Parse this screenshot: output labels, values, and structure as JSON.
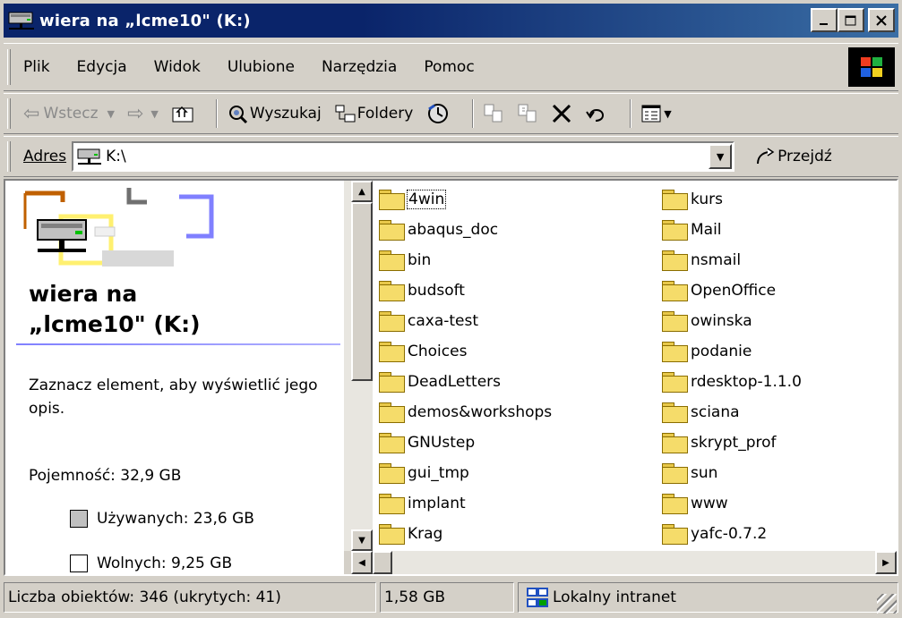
{
  "window": {
    "title": "wiera na „lcme10\" (K:)",
    "icon": "network-drive-icon"
  },
  "menu": {
    "items": [
      "Plik",
      "Edycja",
      "Widok",
      "Ulubione",
      "Narzędzia",
      "Pomoc"
    ]
  },
  "toolbar": {
    "back_label": "Wstecz",
    "search_label": "Wyszukaj",
    "folders_label": "Foldery"
  },
  "address": {
    "label": "Adres",
    "value": "K:\\",
    "go_label": "Przejdź"
  },
  "info_pane": {
    "title_line1": "wiera na",
    "title_line2": "„lcme10\" (K:)",
    "description": "Zaznacz element, aby wyświetlić jego opis.",
    "capacity": "Pojemność: 32,9 GB",
    "used": "Używanych: 23,6 GB",
    "free": "Wolnych: 9,25 GB"
  },
  "files": {
    "column1": [
      "4win",
      "abaqus_doc",
      "bin",
      "budsoft",
      "caxa-test",
      "Choices",
      "DeadLetters",
      "demos&workshops",
      "GNUstep",
      "gui_tmp",
      "implant",
      "Krag"
    ],
    "column2": [
      "kurs",
      "Mail",
      "nsmail",
      "OpenOffice",
      "owinska",
      "podanie",
      "rdesktop-1.1.0",
      "sciana",
      "skrypt_prof",
      "sun",
      "www",
      "yafc-0.7.2"
    ]
  },
  "status": {
    "objects": "Liczba obiektów: 346 (ukrytych: 41)",
    "size": "1,58 GB",
    "zone": "Lokalny intranet"
  },
  "colors": {
    "titlebar": "#0a246a",
    "face": "#d4d0c8",
    "used_swatch": "#c0c0c0",
    "free_swatch": "#ffffff"
  }
}
